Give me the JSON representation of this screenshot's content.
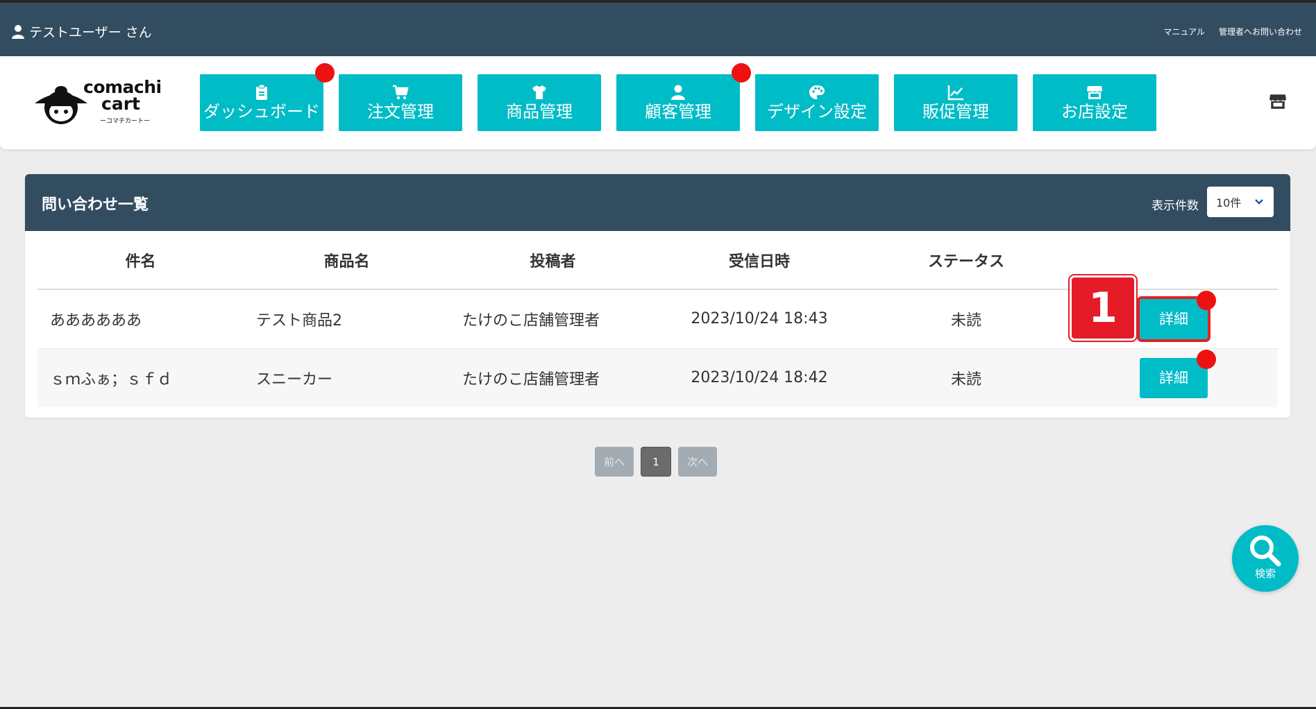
{
  "topbar": {
    "user_name": "テストユーザー さん",
    "links": [
      "マニュアル",
      "管理者へお問い合わせ"
    ]
  },
  "logo": {
    "line1": "comachi",
    "line2": "cart",
    "line3": "ーコマチカートー"
  },
  "nav": {
    "items": [
      {
        "label": "ダッシュボード",
        "icon": "clipboard-icon",
        "notification": true
      },
      {
        "label": "注文管理",
        "icon": "cart-icon",
        "notification": false
      },
      {
        "label": "商品管理",
        "icon": "shirt-icon",
        "notification": false
      },
      {
        "label": "顧客管理",
        "icon": "user-icon",
        "notification": true
      },
      {
        "label": "デザイン設定",
        "icon": "palette-icon",
        "notification": false
      },
      {
        "label": "販促管理",
        "icon": "chart-line-icon",
        "notification": false
      },
      {
        "label": "お店設定",
        "icon": "store-icon",
        "notification": false
      }
    ]
  },
  "panel": {
    "title": "問い合わせ一覧",
    "per_page_label": "表示件数",
    "per_page_value": "10件"
  },
  "table": {
    "headers": [
      "件名",
      "商品名",
      "投稿者",
      "受信日時",
      "ステータス",
      ""
    ],
    "rows": [
      {
        "subject": "ああああああ",
        "product": "テスト商品2",
        "poster": "たけのこ店舗管理者",
        "received": "2023/10/24 18:43",
        "status": "未読",
        "action": "詳細"
      },
      {
        "subject": "ｓｍふぁ；ｓｆｄ",
        "product": "スニーカー",
        "poster": "たけのこ店舗管理者",
        "received": "2023/10/24 18:42",
        "status": "未読",
        "action": "詳細"
      }
    ]
  },
  "annotation": {
    "step": "1"
  },
  "pagination": {
    "prev": "前へ",
    "current": "1",
    "next": "次へ"
  },
  "search_fab": {
    "label": "検索"
  },
  "colors": {
    "header_bg": "#334d60",
    "accent": "#00bcc7",
    "notification": "#ee1111",
    "highlight": "#e51c28"
  }
}
